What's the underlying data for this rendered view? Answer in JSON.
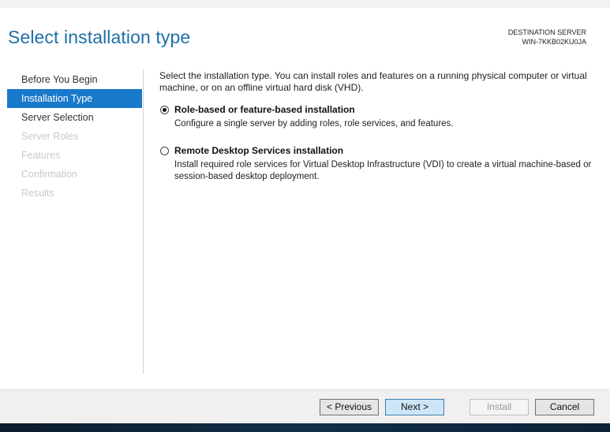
{
  "header": {
    "title": "Select installation type",
    "destination_label": "DESTINATION SERVER",
    "destination_server": "WIN-7KKB02KU0JA"
  },
  "nav": {
    "items": [
      {
        "label": "Before You Begin",
        "state": "normal"
      },
      {
        "label": "Installation Type",
        "state": "active"
      },
      {
        "label": "Server Selection",
        "state": "normal"
      },
      {
        "label": "Server Roles",
        "state": "disabled"
      },
      {
        "label": "Features",
        "state": "disabled"
      },
      {
        "label": "Confirmation",
        "state": "disabled"
      },
      {
        "label": "Results",
        "state": "disabled"
      }
    ]
  },
  "content": {
    "intro": "Select the installation type. You can install roles and features on a running physical computer or virtual machine, or on an offline virtual hard disk (VHD).",
    "options": [
      {
        "title": "Role-based or feature-based installation",
        "description": "Configure a single server by adding roles, role services, and features.",
        "selected": true
      },
      {
        "title": "Remote Desktop Services installation",
        "description": "Install required role services for Virtual Desktop Infrastructure (VDI) to create a virtual machine-based or session-based desktop deployment.",
        "selected": false
      }
    ]
  },
  "footer": {
    "previous_label": "< Previous",
    "next_label": "Next >",
    "install_label": "Install",
    "cancel_label": "Cancel"
  },
  "colors": {
    "accent": "#1979ca",
    "title": "#1e6fa8"
  }
}
